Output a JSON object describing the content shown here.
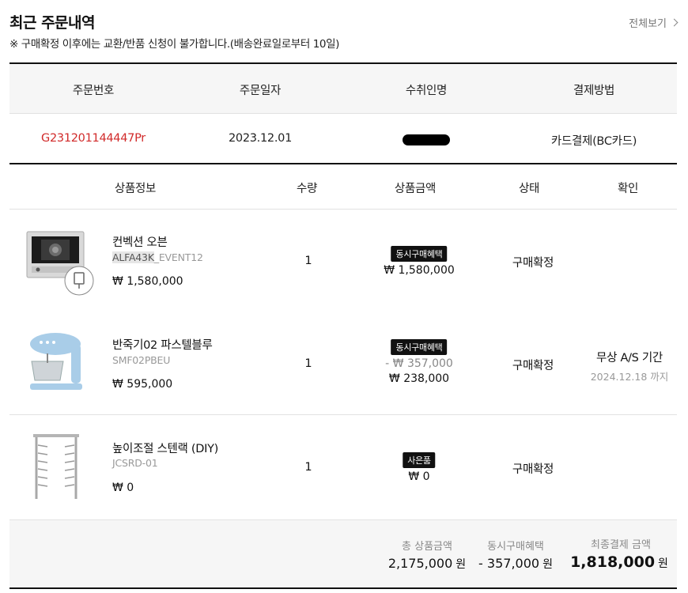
{
  "header": {
    "title": "최근 주문내역",
    "notice": "※ 구매확정 이후에는 교환/반품 신청이 불가합니다.(배송완료일로부터 10일)",
    "view_all": "전체보기"
  },
  "order_table": {
    "columns": [
      "주문번호",
      "주문일자",
      "수취인명",
      "결제방법"
    ],
    "row": {
      "order_no": "G231201144447Pr",
      "date": "2023.12.01",
      "payment": "카드결제(BC카드)"
    }
  },
  "product_table": {
    "columns": [
      "상품정보",
      "수량",
      "상품금액",
      "상태",
      "확인"
    ],
    "items": [
      {
        "name": "컨벡션 오븐",
        "code_highlight": "ALFA43K",
        "code_rest": "_EVENT12",
        "price": "₩ 1,580,000",
        "qty": "1",
        "badge": "동시구매혜택",
        "amount_lines": [
          "₩ 1,580,000"
        ],
        "status": "구매확정",
        "icon": "oven-icon"
      },
      {
        "name": "반죽기02 파스텔블루",
        "code_highlight": "",
        "code_rest": "SMF02PBEU",
        "price": "₩ 595,000",
        "qty": "1",
        "badge": "동시구매혜택",
        "amount_discount": "- ₩ 357,000",
        "amount_lines": [
          "₩ 238,000"
        ],
        "status": "구매확정",
        "as_title": "무상 A/S 기간",
        "as_date": "2024.12.18 까지",
        "icon": "stand-mixer-icon"
      },
      {
        "name": "높이조절 스텐랙 (DIY)",
        "code_highlight": "",
        "code_rest": "JCSRD-01",
        "price": "₩ 0",
        "qty": "1",
        "badge": "사은품",
        "amount_lines": [
          "₩ 0"
        ],
        "status": "구매확정",
        "icon": "steel-rack-icon"
      }
    ]
  },
  "summary": {
    "total_label": "총 상품금액",
    "total_value": "2,175,000",
    "discount_label": "동시구매혜택",
    "discount_value": "- 357,000",
    "final_label": "최종결제 금액",
    "final_value": "1,818,000",
    "unit": "원"
  },
  "colors": {
    "order_no": "#d12a2a",
    "header_bg": "#f6f6f6",
    "badge_bg": "#111111"
  }
}
